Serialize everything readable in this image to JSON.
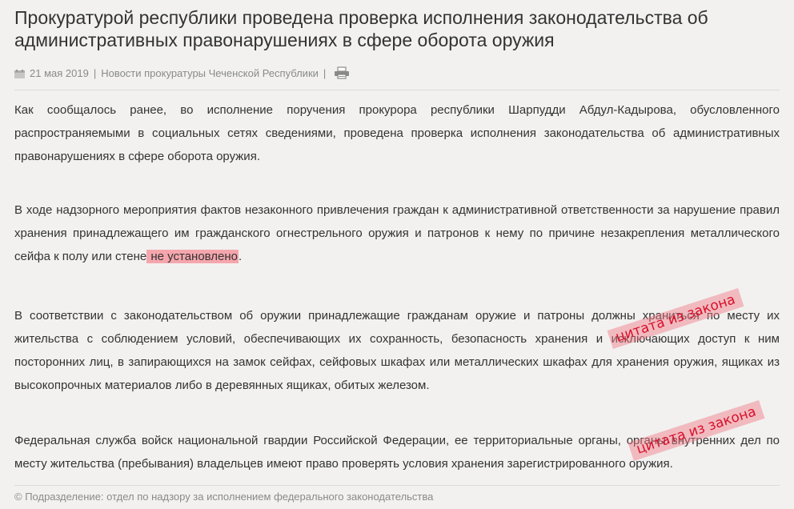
{
  "article": {
    "title": "Прокуратурой республики проведена проверка исполнения законодательства об административных правонарушениях в сфере оборота оружия",
    "date": "21 мая 2019",
    "category": "Новости прокуратуры Чеченской Республики",
    "separator": "|",
    "icons": {
      "date": "calendar-icon",
      "print": "print-icon"
    },
    "p1": "Как сообщалось ранее, во исполнение поручения прокурора республики Шарпудди Абдул-Кадырова, обусловленного распространяемыми в социальных сетях сведениями, проведена проверка исполнения законодательства об административных правонарушениях в сфере оборота оружия.",
    "p2_before": "В ходе надзорного мероприятия фактов незаконного привлечения граждан к административной ответственности за нарушение правил хранения принадлежащего им гражданского огнестрельного оружия и патронов к нему по причине незакрепления металлического сейфа к полу или стене",
    "p2_highlight": " не установлено",
    "p2_after": ".",
    "p3": "В соответствии с законодательством об оружии принадлежащие гражданам оружие и патроны должны храниться по месту их жительства с соблюдением условий, обеспечивающих их сохранность, безопасность хранения и исключающих доступ к ним посторонних лиц, в запирающихся на замок сейфах, сейфовых шкафах или металлических шкафах для хранения оружия, ящиках из высокопрочных материалов либо в деревянных ящиках, обитых железом.",
    "p4": "Федеральная служба войск национальной гвардии Российской Федерации, ее территориальные органы, органы внутренних дел по месту жительства (пребывания) владельцев имеют право проверять условия хранения зарегистрированного оружия.",
    "footer": "© Подразделение: отдел по надзору за исполнением федерального законодательства"
  },
  "stamps": [
    "цитата из закона",
    "цитата из закона"
  ],
  "colors": {
    "highlight": "#f5a6ad",
    "stamp_text": "#d8102a",
    "background": "#f2f1f0"
  }
}
